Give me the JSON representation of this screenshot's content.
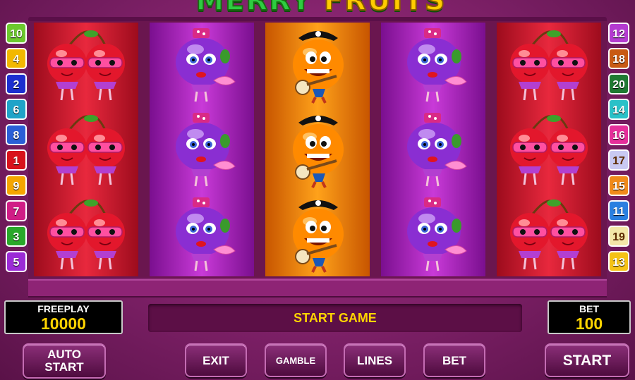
{
  "game": {
    "title_part1": "MERRY",
    "title_part2": "FRUITS"
  },
  "left_lines": [
    {
      "label": "10",
      "color": "#6cc92e"
    },
    {
      "label": "4",
      "color": "#f2b800"
    },
    {
      "label": "2",
      "color": "#1c2fd0"
    },
    {
      "label": "6",
      "color": "#1fa3c8"
    },
    {
      "label": "8",
      "color": "#2a5fd6"
    },
    {
      "label": "1",
      "color": "#d8121b"
    },
    {
      "label": "9",
      "color": "#f5a600"
    },
    {
      "label": "7",
      "color": "#d01d86"
    },
    {
      "label": "3",
      "color": "#2aa82a"
    },
    {
      "label": "5",
      "color": "#9b2bd6"
    }
  ],
  "right_lines": [
    {
      "label": "12",
      "color": "#b43bd0"
    },
    {
      "label": "18",
      "color": "#c85a14"
    },
    {
      "label": "20",
      "color": "#1f7a32"
    },
    {
      "label": "14",
      "color": "#2ac1c8"
    },
    {
      "label": "16",
      "color": "#e52f9a"
    },
    {
      "label": "17",
      "color": "#c9c9f2"
    },
    {
      "label": "15",
      "color": "#f08a1a"
    },
    {
      "label": "11",
      "color": "#2a7fe0"
    },
    {
      "label": "19",
      "color": "#f3e7a8"
    },
    {
      "label": "13",
      "color": "#f5c215"
    }
  ],
  "reels": [
    {
      "symbol": "cherries-icon"
    },
    {
      "symbol": "plum-icon"
    },
    {
      "symbol": "orange-pirate-icon"
    },
    {
      "symbol": "plum-icon"
    },
    {
      "symbol": "cherries-icon"
    }
  ],
  "freeplay": {
    "label": "FREEPLAY",
    "value": "10000"
  },
  "bet": {
    "label": "BET",
    "value": "100"
  },
  "message": "START GAME",
  "buttons": {
    "auto_start_line1": "AUTO",
    "auto_start_line2": "START",
    "exit": "EXIT",
    "gamble": "GAMBLE",
    "lines": "LINES",
    "bet": "BET",
    "start": "START"
  }
}
